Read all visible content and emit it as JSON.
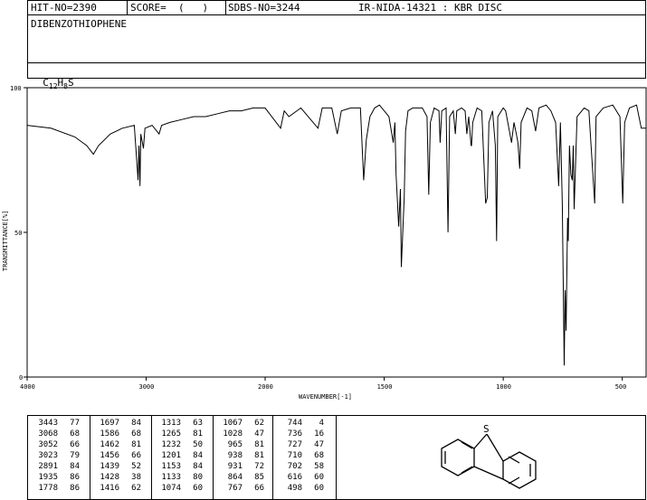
{
  "header": {
    "hit_no": "HIT-NO=2390",
    "score": "SCORE=  (   )",
    "sdbs_no": "SDBS-NO=3244",
    "ir_info": "IR-NIDA-14321 : KBR DISC",
    "compound": "DIBENZOTHIOPHENE",
    "formula_c": "C",
    "formula_c_sub": "12",
    "formula_h": "H",
    "formula_h_sub": "8",
    "formula_s": "S"
  },
  "chart_data": {
    "type": "line",
    "xlabel": "WAVENUMBER[-1]",
    "ylabel": "TRANSMITTANCE[%]",
    "xlim": [
      4000,
      400
    ],
    "ylim": [
      0,
      100
    ],
    "x_ticks": [
      "4000",
      "3000",
      "2000",
      "1500",
      "1000",
      "500"
    ],
    "y_ticks": [
      "100",
      "50",
      "0"
    ],
    "series": [
      {
        "x": [
          4000,
          3800,
          3600,
          3500,
          3443,
          3400,
          3300,
          3200,
          3100,
          3068,
          3060,
          3052,
          3045,
          3023,
          3010,
          2950,
          2891,
          2870,
          2800,
          2700,
          2600,
          2500,
          2400,
          2300,
          2200,
          2100,
          2000,
          1935,
          1920,
          1900,
          1850,
          1778,
          1760,
          1720,
          1697,
          1680,
          1640,
          1600,
          1586,
          1575,
          1560,
          1540,
          1520,
          1500,
          1480,
          1462,
          1455,
          1450,
          1439,
          1432,
          1428,
          1422,
          1416,
          1410,
          1400,
          1380,
          1340,
          1320,
          1313,
          1306,
          1290,
          1270,
          1265,
          1258,
          1240,
          1232,
          1225,
          1210,
          1201,
          1195,
          1175,
          1160,
          1153,
          1145,
          1135,
          1133,
          1128,
          1110,
          1090,
          1074,
          1067,
          1060,
          1045,
          1033,
          1028,
          1023,
          1000,
          990,
          965,
          955,
          945,
          938,
          931,
          925,
          900,
          880,
          864,
          850,
          820,
          800,
          780,
          767,
          760,
          752,
          744,
          740,
          736,
          730,
          727,
          722,
          716,
          710,
          706,
          702,
          690,
          660,
          640,
          616,
          610,
          580,
          540,
          510,
          498,
          490,
          470,
          440,
          420,
          400
        ],
        "y": [
          87,
          86,
          83,
          80,
          77,
          80,
          84,
          86,
          87,
          68,
          80,
          66,
          84,
          79,
          86,
          87,
          84,
          87,
          88,
          89,
          90,
          90,
          91,
          92,
          92,
          93,
          93,
          86,
          92,
          90,
          93,
          86,
          93,
          93,
          84,
          92,
          93,
          93,
          68,
          82,
          90,
          93,
          94,
          92,
          90,
          81,
          88,
          70,
          52,
          65,
          38,
          50,
          62,
          85,
          92,
          93,
          93,
          90,
          63,
          88,
          93,
          92,
          81,
          92,
          93,
          50,
          90,
          92,
          84,
          92,
          93,
          92,
          84,
          90,
          80,
          80,
          88,
          93,
          92,
          60,
          62,
          88,
          92,
          80,
          47,
          90,
          93,
          92,
          81,
          88,
          84,
          81,
          72,
          88,
          93,
          92,
          85,
          93,
          94,
          92,
          88,
          66,
          88,
          60,
          4,
          30,
          16,
          55,
          47,
          80,
          70,
          68,
          80,
          58,
          90,
          93,
          92,
          60,
          90,
          93,
          94,
          90,
          60,
          88,
          93,
          94,
          86,
          86
        ]
      }
    ]
  },
  "peak_table": {
    "columns": [
      [
        [
          "3443",
          "77"
        ],
        [
          "3068",
          "68"
        ],
        [
          "3052",
          "66"
        ],
        [
          "3023",
          "79"
        ],
        [
          "2891",
          "84"
        ],
        [
          "1935",
          "86"
        ],
        [
          "1778",
          "86"
        ]
      ],
      [
        [
          "1697",
          "84"
        ],
        [
          "1586",
          "68"
        ],
        [
          "1462",
          "81"
        ],
        [
          "1456",
          "66"
        ],
        [
          "1439",
          "52"
        ],
        [
          "1428",
          "38"
        ],
        [
          "1416",
          "62"
        ]
      ],
      [
        [
          "1313",
          "63"
        ],
        [
          "1265",
          "81"
        ],
        [
          "1232",
          "50"
        ],
        [
          "1201",
          "84"
        ],
        [
          "1153",
          "84"
        ],
        [
          "1133",
          "80"
        ],
        [
          "1074",
          "60"
        ]
      ],
      [
        [
          "1067",
          "62"
        ],
        [
          "1028",
          "47"
        ],
        [
          "965",
          "81"
        ],
        [
          "938",
          "81"
        ],
        [
          "931",
          "72"
        ],
        [
          "864",
          "85"
        ],
        [
          "767",
          "66"
        ]
      ],
      [
        [
          "744",
          "4"
        ],
        [
          "736",
          "16"
        ],
        [
          "727",
          "47"
        ],
        [
          "710",
          "68"
        ],
        [
          "702",
          "58"
        ],
        [
          "616",
          "60"
        ],
        [
          "498",
          "60"
        ]
      ]
    ]
  },
  "structure": {
    "atom_label": "S"
  }
}
